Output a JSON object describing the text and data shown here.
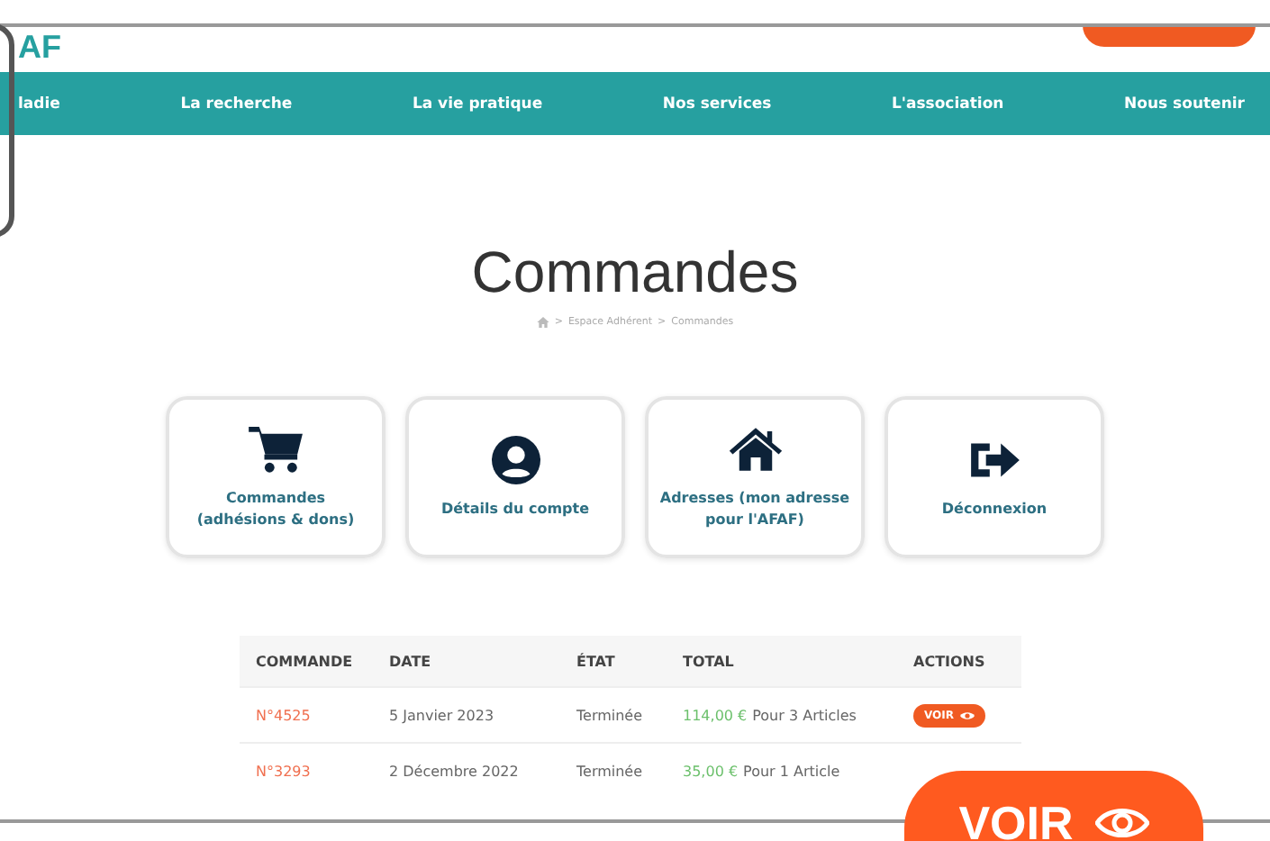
{
  "header": {
    "logo": "AF"
  },
  "nav": [
    "ladie",
    "La recherche",
    "La vie pratique",
    "Nos services",
    "L'association",
    "Nous soutenir"
  ],
  "page": {
    "title": "Commandes",
    "breadcrumb": [
      {
        "separator": ">",
        "label": "Espace Adhérent"
      },
      {
        "separator": ">",
        "label": "Commandes"
      }
    ]
  },
  "cards": [
    {
      "kind": "cart",
      "label": "Commandes (adhésions & dons)"
    },
    {
      "kind": "user",
      "label": "Détails du compte"
    },
    {
      "kind": "home",
      "label": "Adresses (mon adresse pour l'AFAF)"
    },
    {
      "kind": "logout",
      "label": "Déconnexion"
    }
  ],
  "table": {
    "columns": [
      "COMMANDE",
      "DATE",
      "ÉTAT",
      "TOTAL",
      "ACTIONS"
    ],
    "rows": [
      {
        "order": "N°4525",
        "date": "5 Janvier 2023",
        "status": "Terminée",
        "amount": "114,00 €",
        "items": "Pour 3 Articles",
        "action": "VOIR"
      },
      {
        "order": "N°3293",
        "date": "2 Décembre 2022",
        "status": "Terminée",
        "amount": "35,00 €",
        "items": "Pour 1 Article"
      }
    ]
  },
  "magnifier": {
    "label": "VOIR"
  }
}
